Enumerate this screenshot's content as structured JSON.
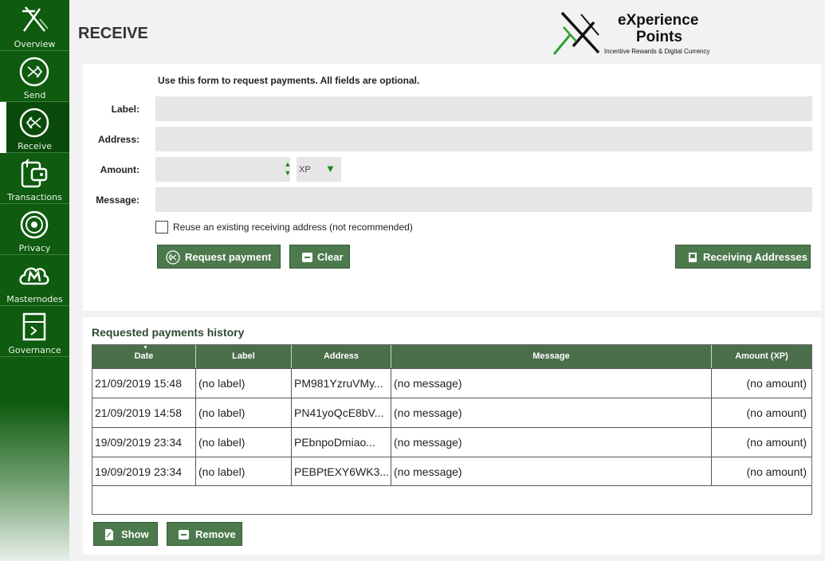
{
  "sidebar": {
    "items": [
      {
        "label": "Overview",
        "icon": "overview-icon"
      },
      {
        "label": "Send",
        "icon": "send-icon"
      },
      {
        "label": "Receive",
        "icon": "receive-icon"
      },
      {
        "label": "Transactions",
        "icon": "transactions-icon"
      },
      {
        "label": "Privacy",
        "icon": "privacy-icon"
      },
      {
        "label": "Masternodes",
        "icon": "masternodes-icon"
      },
      {
        "label": "Governance",
        "icon": "governance-icon"
      }
    ],
    "active_index": 2
  },
  "header": {
    "title": "RECEIVE",
    "logo_line1": "eXperience",
    "logo_line2": "Points",
    "logo_tagline": "Incentive Rewards & Digital Currency"
  },
  "form": {
    "intro": "Use this form to request payments. All fields are optional.",
    "label_label": "Label:",
    "address_label": "Address:",
    "amount_label": "Amount:",
    "message_label": "Message:",
    "label_value": "",
    "address_value": "",
    "amount_value": "",
    "message_value": "",
    "unit": "XP",
    "reuse_label": "Reuse an existing receiving address (not recommended)",
    "reuse_checked": false,
    "request_button": "Request payment",
    "clear_button": "Clear",
    "receiving_addresses_button": "Receiving Addresses"
  },
  "history": {
    "title": "Requested payments history",
    "columns": [
      "Date",
      "Label",
      "Address",
      "Message",
      "Amount (XP)"
    ],
    "rows": [
      [
        "21/09/2019 15:48",
        "(no label)",
        "PM981YzruVMy...",
        "(no message)",
        "(no amount)"
      ],
      [
        "21/09/2019 14:58",
        "(no label)",
        "PN41yoQcE8bV...",
        "(no message)",
        "(no amount)"
      ],
      [
        "19/09/2019 23:34",
        "(no label)",
        "PEbnpoDmiao...",
        "(no message)",
        "(no amount)"
      ],
      [
        "19/09/2019 23:34",
        "(no label)",
        "PEBPtEXY6WK3...",
        "(no message)",
        "(no amount)"
      ]
    ],
    "show_button": "Show",
    "remove_button": "Remove"
  },
  "colors": {
    "sidebar": "#0f5b0f",
    "button": "#4d7a4d",
    "table_header": "#4b6f4b",
    "accent": "#1d8a1d"
  }
}
